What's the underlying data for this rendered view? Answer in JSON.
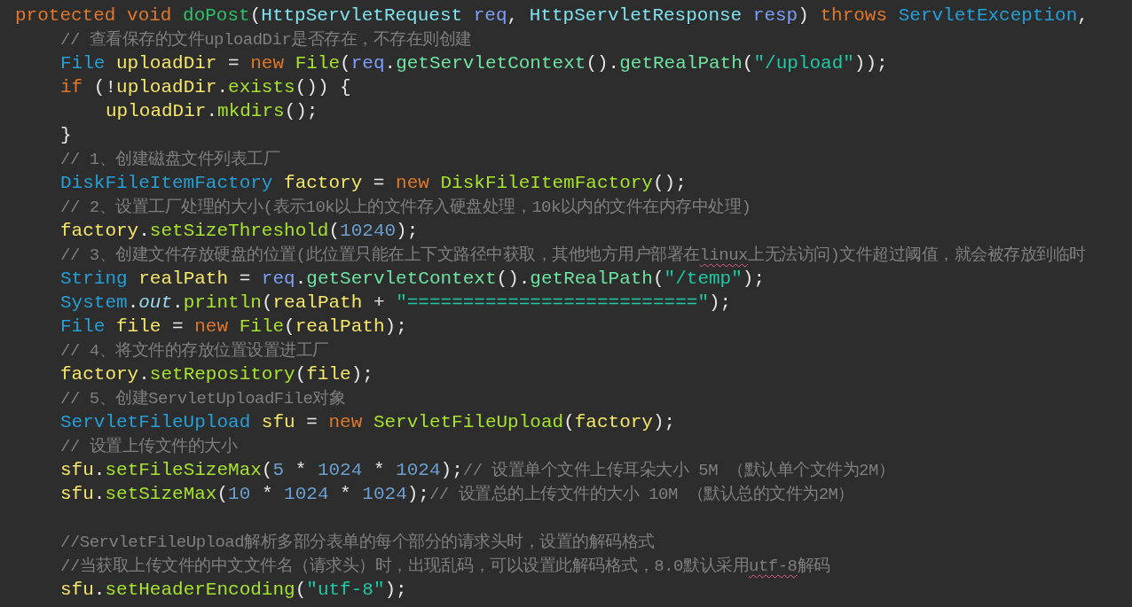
{
  "editor": {
    "lines": [
      {
        "kind": "code",
        "tokens": [
          {
            "kind": "kw",
            "text": "protected "
          },
          {
            "kind": "kw",
            "text": "void "
          },
          {
            "kind": "fn",
            "text": "doPost"
          },
          {
            "kind": "plain",
            "text": "("
          },
          {
            "kind": "ptype",
            "text": "HttpServletRequest "
          },
          {
            "kind": "param",
            "text": "req"
          },
          {
            "kind": "plain",
            "text": ", "
          },
          {
            "kind": "ptype",
            "text": "HttpServletResponse "
          },
          {
            "kind": "param",
            "text": "resp"
          },
          {
            "kind": "plain",
            "text": ") "
          },
          {
            "kind": "kw",
            "text": "throws "
          },
          {
            "kind": "type",
            "text": "ServletException"
          },
          {
            "kind": "plain",
            "text": ","
          }
        ],
        "children": [
          {
            "kind": "code",
            "tokens": [
              {
                "kind": "cmt",
                "text": "// 查看保存的文件uploadDir是否存在，不存在则创建"
              }
            ]
          },
          {
            "kind": "code",
            "tokens": [
              {
                "kind": "type",
                "text": "File "
              },
              {
                "kind": "var",
                "text": "uploadDir"
              },
              {
                "kind": "plain",
                "text": " = "
              },
              {
                "kind": "kw",
                "text": "new "
              },
              {
                "kind": "call",
                "text": "File"
              },
              {
                "kind": "plain",
                "text": "("
              },
              {
                "kind": "param",
                "text": "req"
              },
              {
                "kind": "plain",
                "text": "."
              },
              {
                "kind": "call2",
                "text": "getServletContext"
              },
              {
                "kind": "plain",
                "text": "()."
              },
              {
                "kind": "call2",
                "text": "getRealPath"
              },
              {
                "kind": "plain",
                "text": "("
              },
              {
                "kind": "str",
                "text": "\"/upload\""
              },
              {
                "kind": "plain",
                "text": "));"
              }
            ]
          },
          {
            "kind": "code",
            "tokens": [
              {
                "kind": "kw",
                "text": "if "
              },
              {
                "kind": "plain",
                "text": "(!"
              },
              {
                "kind": "var",
                "text": "uploadDir"
              },
              {
                "kind": "plain",
                "text": "."
              },
              {
                "kind": "call",
                "text": "exists"
              },
              {
                "kind": "plain",
                "text": "()) {"
              }
            ],
            "children": [
              {
                "kind": "code",
                "tokens": [
                  {
                    "kind": "var",
                    "text": "uploadDir"
                  },
                  {
                    "kind": "plain",
                    "text": "."
                  },
                  {
                    "kind": "call",
                    "text": "mkdirs"
                  },
                  {
                    "kind": "plain",
                    "text": "();"
                  }
                ]
              }
            ]
          },
          {
            "kind": "code",
            "tokens": [
              {
                "kind": "plain",
                "text": "}"
              }
            ]
          },
          {
            "kind": "code",
            "tokens": [
              {
                "kind": "cmt",
                "text": "// 1、创建磁盘文件列表工厂"
              }
            ]
          },
          {
            "kind": "code",
            "tokens": [
              {
                "kind": "type",
                "text": "DiskFileItemFactory "
              },
              {
                "kind": "var",
                "text": "factory"
              },
              {
                "kind": "plain",
                "text": " = "
              },
              {
                "kind": "kw",
                "text": "new "
              },
              {
                "kind": "call",
                "text": "DiskFileItemFactory"
              },
              {
                "kind": "plain",
                "text": "();"
              }
            ]
          },
          {
            "kind": "code",
            "tokens": [
              {
                "kind": "cmt",
                "text": "// 2、设置工厂处理的大小(表示10k以上的文件存入硬盘处理，10k以内的文件在内存中处理)"
              }
            ]
          },
          {
            "kind": "code",
            "tokens": [
              {
                "kind": "var",
                "text": "factory"
              },
              {
                "kind": "plain",
                "text": "."
              },
              {
                "kind": "call",
                "text": "setSizeThreshold"
              },
              {
                "kind": "plain",
                "text": "("
              },
              {
                "kind": "num",
                "text": "10240"
              },
              {
                "kind": "plain",
                "text": ");"
              }
            ]
          },
          {
            "kind": "code",
            "tokens": [
              {
                "kind": "cmt",
                "text": "// 3、创建文件存放硬盘的位置(此位置只能在上下文路径中获取，其他地方用户部署在"
              },
              {
                "kind": "typo",
                "text": "linux"
              },
              {
                "kind": "cmt",
                "text": "上无法访问)文件超过阈值，就会被存放到临时"
              }
            ]
          },
          {
            "kind": "code",
            "tokens": [
              {
                "kind": "type",
                "text": "String "
              },
              {
                "kind": "var",
                "text": "realPath"
              },
              {
                "kind": "plain",
                "text": " = "
              },
              {
                "kind": "param",
                "text": "req"
              },
              {
                "kind": "plain",
                "text": "."
              },
              {
                "kind": "call2",
                "text": "getServletContext"
              },
              {
                "kind": "plain",
                "text": "()."
              },
              {
                "kind": "call2",
                "text": "getRealPath"
              },
              {
                "kind": "plain",
                "text": "("
              },
              {
                "kind": "str",
                "text": "\"/temp\""
              },
              {
                "kind": "plain",
                "text": ");"
              }
            ]
          },
          {
            "kind": "code",
            "tokens": [
              {
                "kind": "type",
                "text": "System"
              },
              {
                "kind": "plain",
                "text": "."
              },
              {
                "kind": "field",
                "text": "out"
              },
              {
                "kind": "plain",
                "text": "."
              },
              {
                "kind": "call",
                "text": "println"
              },
              {
                "kind": "plain",
                "text": "("
              },
              {
                "kind": "var",
                "text": "realPath"
              },
              {
                "kind": "plain",
                "text": " + "
              },
              {
                "kind": "str",
                "text": "\"==========================\""
              },
              {
                "kind": "plain",
                "text": ");"
              }
            ]
          },
          {
            "kind": "code",
            "tokens": [
              {
                "kind": "type",
                "text": "File "
              },
              {
                "kind": "var",
                "text": "file"
              },
              {
                "kind": "plain",
                "text": " = "
              },
              {
                "kind": "kw",
                "text": "new "
              },
              {
                "kind": "call",
                "text": "File"
              },
              {
                "kind": "plain",
                "text": "("
              },
              {
                "kind": "var",
                "text": "realPath"
              },
              {
                "kind": "plain",
                "text": ");"
              }
            ]
          },
          {
            "kind": "code",
            "tokens": [
              {
                "kind": "cmt",
                "text": "// 4、将文件的存放位置设置进工厂"
              }
            ]
          },
          {
            "kind": "code",
            "tokens": [
              {
                "kind": "var",
                "text": "factory"
              },
              {
                "kind": "plain",
                "text": "."
              },
              {
                "kind": "call",
                "text": "setRepository"
              },
              {
                "kind": "plain",
                "text": "("
              },
              {
                "kind": "var",
                "text": "file"
              },
              {
                "kind": "plain",
                "text": ");"
              }
            ]
          },
          {
            "kind": "code",
            "tokens": [
              {
                "kind": "cmt",
                "text": "// 5、创建ServletUploadFile对象"
              }
            ]
          },
          {
            "kind": "code",
            "tokens": [
              {
                "kind": "type",
                "text": "ServletFileUpload "
              },
              {
                "kind": "var",
                "text": "sfu"
              },
              {
                "kind": "plain",
                "text": " = "
              },
              {
                "kind": "kw",
                "text": "new "
              },
              {
                "kind": "call",
                "text": "ServletFileUpload"
              },
              {
                "kind": "plain",
                "text": "("
              },
              {
                "kind": "var",
                "text": "factory"
              },
              {
                "kind": "plain",
                "text": ");"
              }
            ]
          },
          {
            "kind": "code",
            "tokens": [
              {
                "kind": "cmt",
                "text": "// 设置上传文件的大小"
              }
            ]
          },
          {
            "kind": "code",
            "tokens": [
              {
                "kind": "var",
                "text": "sfu"
              },
              {
                "kind": "plain",
                "text": "."
              },
              {
                "kind": "call",
                "text": "setFileSizeMax"
              },
              {
                "kind": "plain",
                "text": "("
              },
              {
                "kind": "num",
                "text": "5"
              },
              {
                "kind": "plain",
                "text": " * "
              },
              {
                "kind": "num",
                "text": "1024"
              },
              {
                "kind": "plain",
                "text": " * "
              },
              {
                "kind": "num",
                "text": "1024"
              },
              {
                "kind": "plain",
                "text": ");"
              },
              {
                "kind": "cmt",
                "text": "// 设置单个文件上传耳朵大小 5M （默认单个文件为2M）"
              }
            ]
          },
          {
            "kind": "code",
            "tokens": [
              {
                "kind": "var",
                "text": "sfu"
              },
              {
                "kind": "plain",
                "text": "."
              },
              {
                "kind": "call",
                "text": "setSizeMax"
              },
              {
                "kind": "plain",
                "text": "("
              },
              {
                "kind": "num",
                "text": "10"
              },
              {
                "kind": "plain",
                "text": " * "
              },
              {
                "kind": "num",
                "text": "1024"
              },
              {
                "kind": "plain",
                "text": " * "
              },
              {
                "kind": "num",
                "text": "1024"
              },
              {
                "kind": "plain",
                "text": ");"
              },
              {
                "kind": "cmt",
                "text": "// 设置总的上传文件的大小 10M （默认总的文件为2M）"
              }
            ]
          },
          {
            "kind": "blank"
          },
          {
            "kind": "code",
            "tokens": [
              {
                "kind": "cmt",
                "text": "//ServletFileUpload解析多部分表单的每个部分的请求头时，设置的解码格式"
              }
            ]
          },
          {
            "kind": "code",
            "tokens": [
              {
                "kind": "cmt",
                "text": "//当获取上传文件的中文文件名（请求头）时，出现乱码，可以设置此解码格式，8.0默认采用"
              },
              {
                "kind": "typo",
                "text": "utf-8"
              },
              {
                "kind": "cmt",
                "text": "解码"
              }
            ]
          },
          {
            "kind": "code",
            "tokens": [
              {
                "kind": "var",
                "text": "sfu"
              },
              {
                "kind": "plain",
                "text": "."
              },
              {
                "kind": "call",
                "text": "setHeaderEncoding"
              },
              {
                "kind": "plain",
                "text": "("
              },
              {
                "kind": "str",
                "text": "\"utf-8\""
              },
              {
                "kind": "plain",
                "text": ");"
              }
            ]
          }
        ]
      }
    ]
  }
}
